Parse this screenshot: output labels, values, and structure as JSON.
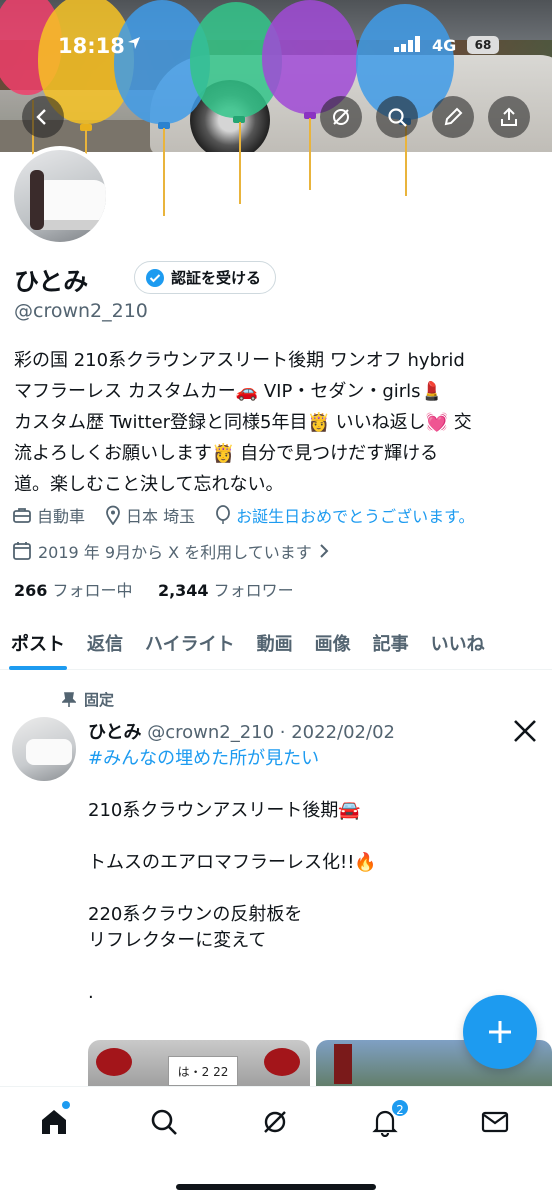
{
  "status_bar": {
    "time": "18:18",
    "network": "4G",
    "battery": "68"
  },
  "profile": {
    "name": "ひとみ",
    "verify_label": "認証を受ける",
    "handle": "@crown2_210",
    "bio_lines": [
      "彩の国 210系クラウンアスリート後期 ワンオフ hybrid",
      "マフラーレス カスタムカー🚗 VIP・セダン・girls💄",
      "カスタム歴 Twitter登録と同様5年目👸 いいね返し💓 交",
      "流よろしくお願いします👸 自分で見つけだす輝ける",
      "道。楽しむこと決して忘れない。"
    ],
    "category": "自動車",
    "location": "日本 埼玉",
    "birthday": "お誕生日おめでとうございます。",
    "joined": "2019 年 9月から X を利用しています",
    "following_count": "266",
    "following_label": "フォロー中",
    "followers_count": "2,344",
    "followers_label": "フォロワー"
  },
  "tabs": [
    "ポスト",
    "返信",
    "ハイライト",
    "動画",
    "画像",
    "記事",
    "いいね"
  ],
  "post": {
    "pinned_label": "固定",
    "author": "ひとみ",
    "handle_date": "@crown2_210 · 2022/02/02",
    "hashtag": "#みんなの埋めた所が見たい",
    "lines": [
      "",
      "210系クラウンアスリート後期🚘",
      "",
      "トムスのエアロマフラーレス化!!🔥",
      "",
      "220系クラウンの反射板を",
      "リフレクターに変えて",
      "",
      "."
    ],
    "plate_text": "は・2 22"
  },
  "nav": {
    "notifications_badge": "2"
  },
  "colors": {
    "accent": "#1d9bf0",
    "text": "#0f1419",
    "muted": "#536471"
  },
  "icons": [
    "back-icon",
    "grok-icon",
    "search-icon",
    "edit-icon",
    "share-icon",
    "verified-icon",
    "briefcase-icon",
    "location-icon",
    "balloon-icon",
    "calendar-icon",
    "pin-icon",
    "x-logo-icon",
    "plus-icon",
    "home-icon",
    "notifications-icon",
    "messages-icon"
  ]
}
